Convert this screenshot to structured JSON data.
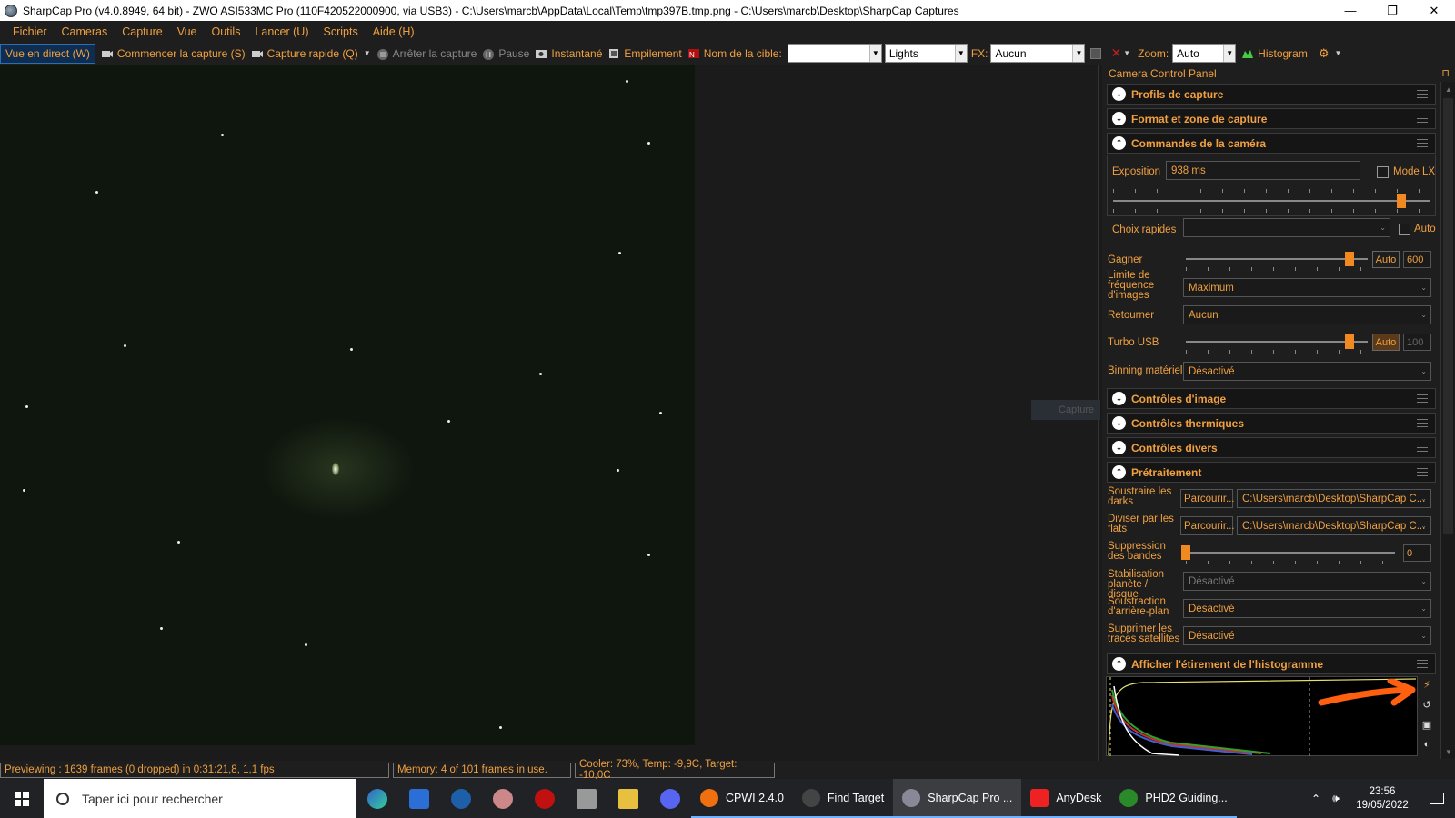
{
  "window": {
    "title": "SharpCap Pro (v4.0.8949, 64 bit) - ZWO ASI533MC Pro (110F420522000900, via USB3) - C:\\Users\\marcb\\AppData\\Local\\Temp\\tmp397B.tmp.png - C:\\Users\\marcb\\Desktop\\SharpCap Captures",
    "minimize": "—",
    "maximize": "❐",
    "close": "✕"
  },
  "menu": [
    "Fichier",
    "Cameras",
    "Capture",
    "Vue",
    "Outils",
    "Lancer (U)",
    "Scripts",
    "Aide (H)"
  ],
  "toolbar": {
    "live_view": "Vue en direct (W)",
    "start_capture": "Commencer la capture (S)",
    "quick_capture": "Capture rapide (Q)",
    "stop_capture": "Arrêter la capture",
    "pause": "Pause",
    "snapshot": "Instantané",
    "stacking": "Empilement",
    "target_name_label": "Nom de la cible:",
    "target_name_value": "",
    "frame_type": "Lights",
    "fx_label": "FX:",
    "fx_value": "Aucun",
    "zoom_label": "Zoom:",
    "zoom_value": "Auto",
    "histogram": "Histogram"
  },
  "viewport": {
    "ghost_label": "Capture"
  },
  "panel": {
    "title": "Camera Control Panel",
    "sections": {
      "profiles": "Profils de capture",
      "format": "Format et zone de capture",
      "camera_controls": "Commandes de la caméra",
      "image_controls": "Contrôles d'image",
      "thermal_controls": "Contrôles thermiques",
      "misc_controls": "Contrôles divers",
      "preprocessing": "Prétraitement",
      "histogram_stretch": "Afficher l'étirement de l'histogramme"
    },
    "exposure": {
      "label": "Exposition",
      "value": "938 ms",
      "lx_label": "Mode LX",
      "slider_level": 0.91
    },
    "quick_picks": {
      "label": "Choix rapides",
      "value": "",
      "auto_label": "Auto"
    },
    "gain": {
      "label": "Gagner",
      "auto_label": "Auto",
      "value": "600",
      "slider_level": 0.9
    },
    "frame_rate_limit": {
      "label": "Limite de fréquence d'images",
      "value": "Maximum"
    },
    "flip": {
      "label": "Retourner",
      "value": "Aucun"
    },
    "usb_turbo": {
      "label": "Turbo USB",
      "auto_label": "Auto",
      "value": "100",
      "slider_level": 0.9
    },
    "hardware_binning": {
      "label": "Binning matériel",
      "value": "Désactivé"
    },
    "subtract_darks": {
      "label": "Soustraire les darks",
      "browse": "Parcourir...",
      "path": "C:\\Users\\marcb\\Desktop\\SharpCap C..."
    },
    "divide_flats": {
      "label": "Diviser par les flats",
      "browse": "Parcourir...",
      "path": "C:\\Users\\marcb\\Desktop\\SharpCap C..."
    },
    "banding_suppression": {
      "label": "Suppression des bandes",
      "value": "0",
      "slider_level": 0.0
    },
    "planet_stabilization": {
      "label": "Stabilisation planète / disque",
      "value": "Désactivé"
    },
    "background_subtraction": {
      "label": "Soustraction d'arrière-plan",
      "value": "Désactivé"
    },
    "satellite_trails": {
      "label": "Supprimer les traces satellites",
      "value": "Désactivé"
    }
  },
  "status": {
    "previewing": "Previewing : 1639 frames (0 dropped) in 0:31:21,8, 1,1 fps",
    "memory": "Memory: 4 of 101 frames in use.",
    "cooler": "Cooler: 73%, Temp: -9,9C, Target: -10,0C"
  },
  "taskbar": {
    "search_placeholder": "Taper ici pour rechercher",
    "apps": [
      "CPWI 2.4.0",
      "Find Target",
      "SharpCap Pro ...",
      "AnyDesk",
      "PHD2 Guiding..."
    ],
    "time": "23:56",
    "date": "19/05/2022"
  },
  "colors": {
    "accent": "#f0a040",
    "background": "#1e1e1e",
    "slider_thumb": "#f08a20"
  }
}
